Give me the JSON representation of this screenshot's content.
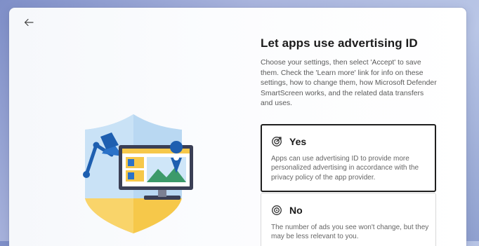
{
  "page": {
    "title": "Let apps use advertising ID",
    "description": "Choose your settings, then select 'Accept' to save them. Check the 'Learn more' link for info on these settings, how to change them, how Microsoft Defender SmartScreen works, and the related data transfers and uses."
  },
  "nav": {
    "back_icon": "back-arrow-icon"
  },
  "options": [
    {
      "label": "Yes",
      "icon": "target-check-icon",
      "description": "Apps can use advertising ID to provide more personalized advertising in accordance with the privacy policy of the app provider.",
      "selected": true
    },
    {
      "label": "No",
      "icon": "target-off-icon",
      "description": "The number of ads you see won't change, but they may be less relevant to you.",
      "selected": false
    }
  ],
  "colors": {
    "accent": "#0f6cbd",
    "selected_border": "#1f1f1f",
    "shield_blue": "#b9d8f2",
    "shield_yellow": "#f6c84a"
  }
}
